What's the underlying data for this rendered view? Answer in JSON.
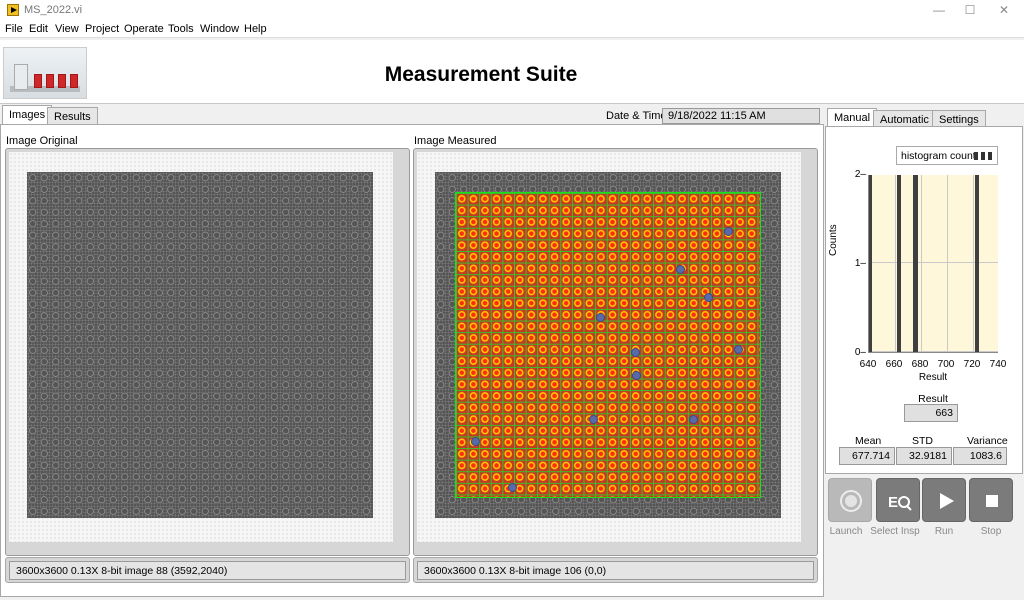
{
  "window": {
    "title": "MS_2022.vi",
    "controls": [
      "—",
      "☐",
      "✕"
    ]
  },
  "menu": [
    "File",
    "Edit",
    "View",
    "Project",
    "Operate",
    "Tools",
    "Window",
    "Help"
  ],
  "header": {
    "title": "Measurement Suite"
  },
  "left_tabs": [
    "Images",
    "Results"
  ],
  "datetime": {
    "label": "Date & Time:",
    "value": "9/18/2022  11:15 AM"
  },
  "image_original": {
    "label": "Image Original",
    "status": "3600x3600 0.13X 8-bit image 88    (3592,2040)"
  },
  "image_measured": {
    "label": "Image Measured",
    "status": "3600x3600 0.13X 8-bit image 106    (0,0)"
  },
  "right_tabs": [
    "Manual",
    "Automatic",
    "Settings"
  ],
  "histogram": {
    "legend": "histogram count"
  },
  "chart_data": {
    "type": "bar",
    "title": "",
    "xlabel": "Result",
    "ylabel": "Counts",
    "xlim": [
      640,
      740
    ],
    "ylim": [
      0,
      2
    ],
    "x_ticks": [
      "640",
      "660",
      "680",
      "700",
      "720",
      "740"
    ],
    "y_ticks": [
      "0",
      "1",
      "2"
    ],
    "series": [
      {
        "name": "histogram count",
        "x": [
          641,
          663,
          675,
          676,
          723
        ],
        "values": [
          2,
          2,
          2,
          2,
          2
        ]
      }
    ]
  },
  "result": {
    "label": "Result",
    "value": "663"
  },
  "stats": {
    "mean_label": "Mean",
    "mean": "677.714",
    "std_label": "STD",
    "std": "32.9181",
    "variance_label": "Variance",
    "variance": "1083.6"
  },
  "actions": {
    "launch": "Launch",
    "select_insp": "Select Insp",
    "run": "Run",
    "stop": "Stop"
  }
}
